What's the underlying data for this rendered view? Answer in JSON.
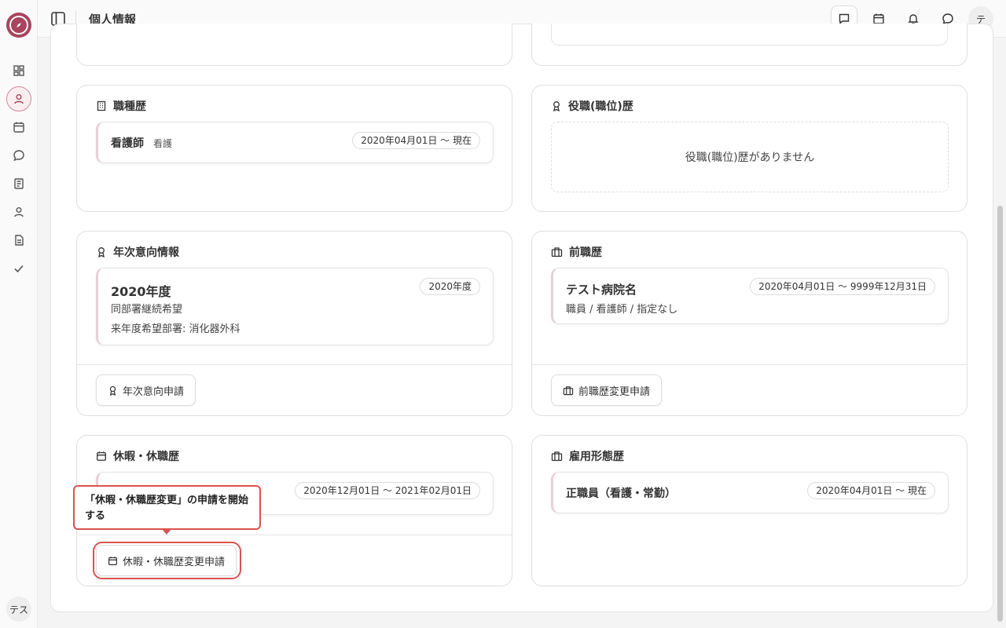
{
  "header": {
    "title": "個人情報",
    "user_initial": "テ"
  },
  "rail": {
    "avatar_label": "テス"
  },
  "job_history": {
    "title": "職種歴",
    "item": {
      "name": "看護師",
      "sub": "看護",
      "period": "2020年04月01日 〜 現在"
    }
  },
  "position_history": {
    "title": "役職(職位)歴",
    "empty": "役職(職位)歴がありません"
  },
  "annual_intent": {
    "title": "年次意向情報",
    "item": {
      "year_title": "2020年度",
      "badge": "2020年度",
      "line1": "同部署継続希望",
      "line2": "来年度希望部署: 消化器外科"
    },
    "button": "年次意向申請"
  },
  "previous_job": {
    "title": "前職歴",
    "item": {
      "name": "テスト病院名",
      "period": "2020年04月01日 〜 9999年12月31日",
      "sub": "職員 / 看護師 / 指定なし"
    },
    "button": "前職歴変更申請"
  },
  "leave_history": {
    "title": "休暇・休職歴",
    "item": {
      "period": "2020年12月01日 〜 2021年02月01日"
    },
    "button": "休暇・休職歴変更申請",
    "tooltip": "「休暇・休職歴変更」の申請を開始する"
  },
  "employment_history": {
    "title": "雇用形態歴",
    "item": {
      "name": "正職員（看護・常勤）",
      "period": "2020年04月01日 〜 現在"
    }
  },
  "colors": {
    "brand": "#a8445c",
    "highlight": "#d9534f"
  }
}
